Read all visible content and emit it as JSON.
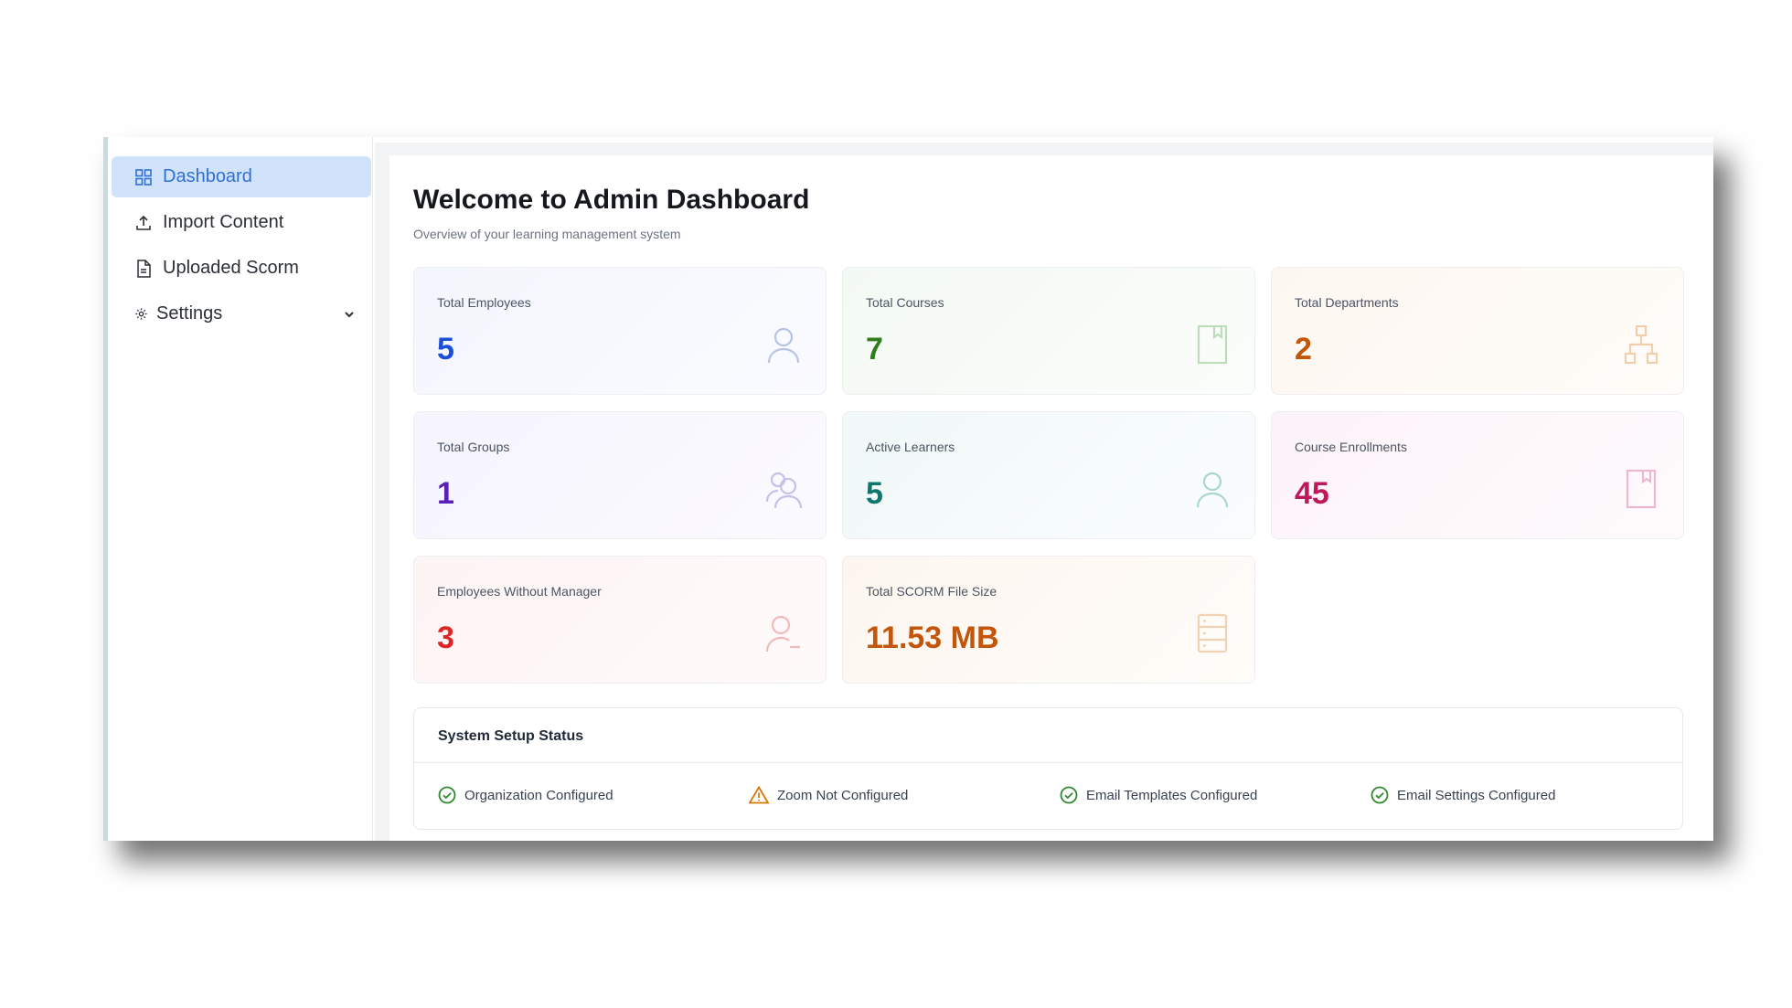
{
  "sidebar": {
    "items": [
      {
        "label": "Dashboard",
        "icon": "dashboard-grid-icon",
        "active": true
      },
      {
        "label": "Import Content",
        "icon": "upload-icon"
      },
      {
        "label": "Uploaded Scorm",
        "icon": "document-icon"
      },
      {
        "label": "Settings",
        "icon": "gear-icon",
        "expandable": true
      }
    ]
  },
  "header": {
    "title": "Welcome to Admin Dashboard",
    "subtitle": "Overview of your learning management system"
  },
  "stats": [
    {
      "label": "Total Employees",
      "value": "5",
      "color": "#1d4ed8",
      "icon": "user-icon"
    },
    {
      "label": "Total Courses",
      "value": "7",
      "color": "#2f7d1c",
      "icon": "book-icon"
    },
    {
      "label": "Total Departments",
      "value": "2",
      "color": "#c2570c",
      "icon": "org-chart-icon"
    },
    {
      "label": "Total Groups",
      "value": "1",
      "color": "#5b21b6",
      "icon": "users-icon"
    },
    {
      "label": "Active Learners",
      "value": "5",
      "color": "#0f766e",
      "icon": "user-icon"
    },
    {
      "label": "Course Enrollments",
      "value": "45",
      "color": "#be185d",
      "icon": "book-icon"
    },
    {
      "label": "Employees Without Manager",
      "value": "3",
      "color": "#dc2626",
      "icon": "user-minus-icon"
    },
    {
      "label": "Total SCORM File Size",
      "value": "11.53 MB",
      "color": "#c2570c",
      "icon": "server-icon"
    }
  ],
  "setup_status": {
    "title": "System Setup Status",
    "items": [
      {
        "label": "Organization Configured",
        "state": "ok",
        "icon": "check-circle-icon"
      },
      {
        "label": "Zoom Not Configured",
        "state": "warning",
        "icon": "warning-triangle-icon"
      },
      {
        "label": "Email Templates Configured",
        "state": "ok",
        "icon": "check-circle-icon"
      },
      {
        "label": "Email Settings Configured",
        "state": "ok",
        "icon": "check-circle-icon"
      }
    ]
  },
  "colors": {
    "accent": "#2f6fd6",
    "ok": "#2f8a2f",
    "warning": "#d97706"
  }
}
